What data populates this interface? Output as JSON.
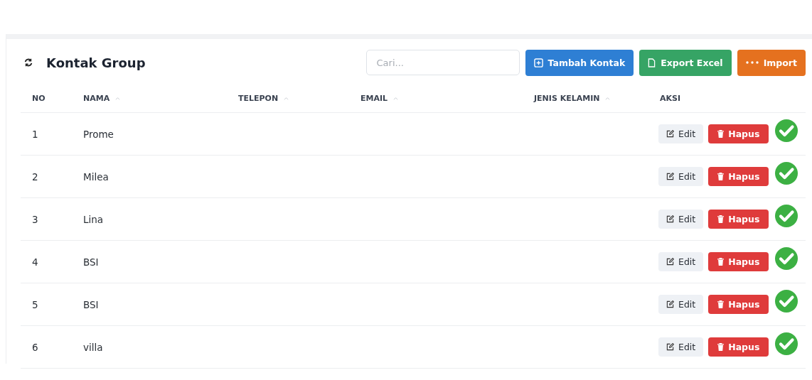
{
  "title": "Kontak Group",
  "search": {
    "placeholder": "Cari..."
  },
  "buttons": [
    {
      "label": "Tambah Kontak",
      "kind": "add"
    },
    {
      "label": "Export Excel",
      "kind": "export"
    },
    {
      "label": "Import",
      "kind": "import"
    }
  ],
  "table": {
    "columns": [
      {
        "label": "NO",
        "sortable": false
      },
      {
        "label": "NAMA",
        "sortable": true
      },
      {
        "label": "TELEPON",
        "sortable": true
      },
      {
        "label": "EMAIL",
        "sortable": true
      },
      {
        "label": "JENIS KELAMIN",
        "sortable": true
      },
      {
        "label": "AKSI",
        "sortable": false
      }
    ],
    "rows": [
      {
        "no": "1",
        "nama": "Prome",
        "edit": "Edit",
        "delete": "Hapus",
        "verified": true
      },
      {
        "no": "2",
        "nama": "Milea",
        "edit": "Edit",
        "delete": "Hapus",
        "verified": true
      },
      {
        "no": "3",
        "nama": "Lina",
        "edit": "Edit",
        "delete": "Hapus",
        "verified": true
      },
      {
        "no": "4",
        "nama": "BSI",
        "edit": "Edit",
        "delete": "Hapus",
        "verified": true
      },
      {
        "no": "5",
        "nama": "BSI",
        "edit": "Edit",
        "delete": "Hapus",
        "verified": true
      },
      {
        "no": "6",
        "nama": "villa",
        "edit": "Edit",
        "delete": "Hapus",
        "verified": true
      }
    ]
  }
}
